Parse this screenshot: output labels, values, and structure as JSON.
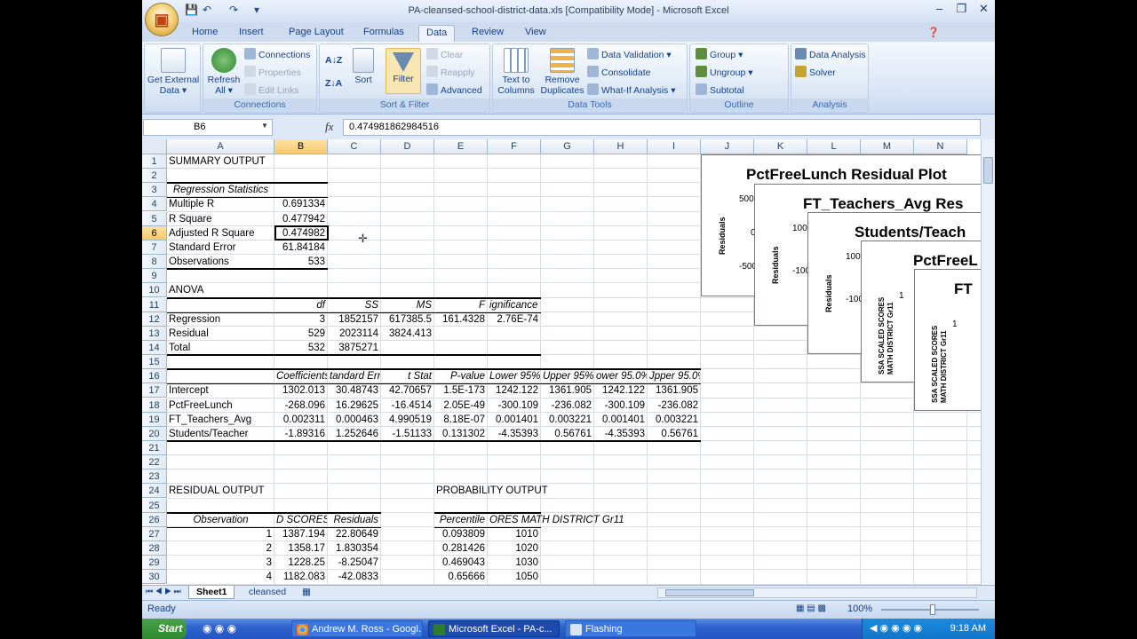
{
  "window": {
    "title": "PA-cleansed-school-district-data.xls  [Compatibility Mode] - Microsoft Excel"
  },
  "ribbon_tabs": [
    "Home",
    "Insert",
    "Page Layout",
    "Formulas",
    "Data",
    "Review",
    "View"
  ],
  "active_tab": "Data",
  "ribbon": {
    "get_external_data": "Get External Data",
    "refresh_all": "Refresh All",
    "connections": "Connections",
    "properties": "Properties",
    "edit_links": "Edit Links",
    "connections_group": "Connections",
    "sort": "Sort",
    "filter": "Filter",
    "clear": "Clear",
    "reapply": "Reapply",
    "advanced": "Advanced",
    "sort_filter_group": "Sort & Filter",
    "text_to_columns": "Text to Columns",
    "remove_duplicates": "Remove Duplicates",
    "data_validation": "Data Validation",
    "consolidate": "Consolidate",
    "what_if": "What-If Analysis",
    "data_tools_group": "Data Tools",
    "group": "Group",
    "ungroup": "Ungroup",
    "subtotal": "Subtotal",
    "outline_group": "Outline",
    "data_analysis": "Data Analysis",
    "solver": "Solver",
    "analysis_group": "Analysis"
  },
  "formula_bar": {
    "name_box": "B6",
    "fx": "fx",
    "formula": "0.474981862984516"
  },
  "columns": [
    "A",
    "B",
    "C",
    "D",
    "E",
    "F",
    "G",
    "H",
    "I",
    "J",
    "K",
    "L",
    "M",
    "N"
  ],
  "rows": [
    "1",
    "2",
    "3",
    "4",
    "5",
    "6",
    "7",
    "8",
    "9",
    "10",
    "11",
    "12",
    "13",
    "14",
    "15",
    "16",
    "17",
    "18",
    "19",
    "20",
    "21",
    "22",
    "23",
    "24",
    "25",
    "26",
    "27",
    "28",
    "29",
    "30"
  ],
  "cells": {
    "A1": "SUMMARY OUTPUT",
    "A3": "Regression Statistics",
    "A4": "Multiple R",
    "B4": "0.691334",
    "A5": "R Square",
    "B5": "0.477942",
    "A6": "Adjusted R Square",
    "B6": "0.474982",
    "A7": "Standard Error",
    "B7": "61.84184",
    "A8": "Observations",
    "B8": "533",
    "A10": "ANOVA",
    "B11": "df",
    "C11": "SS",
    "D11": "MS",
    "E11": "F",
    "F11": "ignificance F",
    "A12": "Regression",
    "B12": "3",
    "C12": "1852157",
    "D12": "617385.5",
    "E12": "161.4328",
    "F12": "2.76E-74",
    "A13": "Residual",
    "B13": "529",
    "C13": "2023114",
    "D13": "3824.413",
    "A14": "Total",
    "B14": "532",
    "C14": "3875271",
    "B16": "Coefficients",
    "C16": "tandard Err",
    "D16": "t Stat",
    "E16": "P-value",
    "F16": "Lower 95%",
    "G16": "Upper 95%",
    "H16": "ower 95.0%",
    "I16": "Jpper 95.0%",
    "A17": "Intercept",
    "B17": "1302.013",
    "C17": "30.48743",
    "D17": "42.70657",
    "E17": "1.5E-173",
    "F17": "1242.122",
    "G17": "1361.905",
    "H17": "1242.122",
    "I17": "1361.905",
    "A18": "PctFreeLunch",
    "B18": "-268.096",
    "C18": "16.29625",
    "D18": "-16.4514",
    "E18": "2.05E-49",
    "F18": "-300.109",
    "G18": "-236.082",
    "H18": "-300.109",
    "I18": "-236.082",
    "A19": "FT_Teachers_Avg",
    "B19": "0.002311",
    "C19": "0.000463",
    "D19": "4.990519",
    "E19": "8.18E-07",
    "F19": "0.001401",
    "G19": "0.003221",
    "H19": "0.001401",
    "I19": "0.003221",
    "A20": "Students/Teacher",
    "B20": "-1.89316",
    "C20": "1.252646",
    "D20": "-1.51133",
    "E20": "0.131302",
    "F20": "-4.35393",
    "G20": "0.56761",
    "H20": "-4.35393",
    "I20": "0.56761",
    "A24": "RESIDUAL OUTPUT",
    "E24": "PROBABILITY OUTPUT",
    "A26": "Observation",
    "B26": "D SCORES",
    "C26": "Residuals",
    "E26": "Percentile",
    "F26": "ORES MATH DISTRICT Gr11",
    "A27": "1",
    "B27": "1387.194",
    "C27": "22.80649",
    "E27": "0.093809",
    "F27": "1010",
    "A28": "2",
    "B28": "1358.17",
    "C28": "1.830354",
    "E28": "0.281426",
    "F28": "1020",
    "A29": "3",
    "B29": "1228.25",
    "C29": "-8.25047",
    "E29": "0.469043",
    "F29": "1030",
    "A30": "4",
    "B30": "1182.083",
    "C30": "-42.0833",
    "E30": "0.65666",
    "F30": "1050"
  },
  "charts": [
    {
      "title": "PctFreeLunch  Residual Plot",
      "ylabel": "Residuals",
      "ticks": [
        "500",
        "0",
        "-500"
      ]
    },
    {
      "title": "FT_Teachers_Avg  Res",
      "ylabel": "Residuals",
      "ticks": [
        "100",
        "-100"
      ]
    },
    {
      "title": "Students/Teach",
      "ylabel": "Residuals",
      "ticks": [
        "100",
        "-100"
      ]
    },
    {
      "title": "PctFreeL",
      "ylabel": "SSA SCALED SCORES MATH DISTRICT Gr11",
      "ticks": [
        "1"
      ]
    },
    {
      "title": "FT",
      "ylabel": "SSA SCALED SCORES MATH DISTRICT Gr11",
      "ticks": [
        "1"
      ]
    }
  ],
  "sheets": [
    "Sheet1",
    "cleansed"
  ],
  "active_sheet": "Sheet1",
  "status": {
    "ready": "Ready",
    "zoom": "100%"
  },
  "taskbar": {
    "start": "Start",
    "tasks": [
      "Andrew M. Ross - Googl...",
      "Microsoft Excel - PA-c...",
      "Flashing"
    ],
    "clock": "9:18 AM"
  }
}
